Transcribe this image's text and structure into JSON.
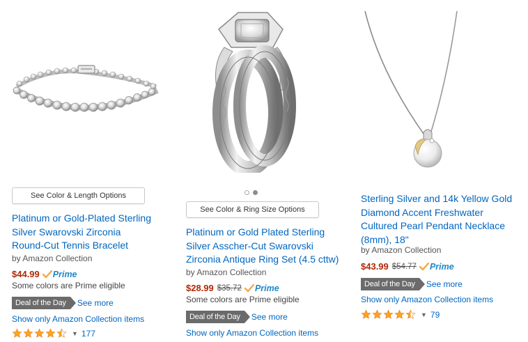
{
  "products": [
    {
      "option_button": "See Color & Length Options",
      "title_lines": [
        "Platinum or Gold-Plated Sterling",
        "Silver Swarovski Zirconia",
        "Round-Cut Tennis Bracelet"
      ],
      "byline": "by Amazon Collection",
      "price": "$44.99",
      "list_price": "",
      "prime_label": "Prime",
      "note": "Some colors are Prime eligible",
      "deal_badge": "Deal of the Day",
      "see_more": "See more",
      "brand_link": "Show only Amazon Collection items",
      "rating_stars": 4.5,
      "review_count": "177"
    },
    {
      "option_button": "See Color & Ring Size Options",
      "title_lines": [
        "Platinum or Gold Plated Sterling",
        "Silver Asscher-Cut Swarovski",
        "Zirconia Antique Ring Set (4.5 cttw)"
      ],
      "byline": "by Amazon Collection",
      "price": "$28.99",
      "list_price": "$35.72",
      "prime_label": "Prime",
      "note": "Some colors are Prime eligible",
      "deal_badge": "Deal of the Day",
      "see_more": "See more",
      "brand_link": "Show only Amazon Collection items",
      "carousel_dots": 2,
      "carousel_active": 2
    },
    {
      "title_lines": [
        "Sterling Silver and 14k Yellow Gold",
        "Diamond Accent Freshwater",
        "Cultured Pearl Pendant Necklace",
        "(8mm), 18\""
      ],
      "byline": "by Amazon Collection",
      "price": "$43.99",
      "list_price": "$54.77",
      "prime_label": "Prime",
      "deal_badge": "Deal of the Day",
      "see_more": "See more",
      "brand_link": "Show only Amazon Collection items",
      "rating_stars": 4.5,
      "review_count": "79"
    }
  ],
  "colors": {
    "link": "#0066c0",
    "price": "#b12704",
    "prime": "#1f88c9",
    "star": "#ffa41c",
    "deal_badge": "#6b6b6b"
  },
  "icons": [
    "prime-check-icon",
    "star-icon",
    "caret-down-icon"
  ]
}
